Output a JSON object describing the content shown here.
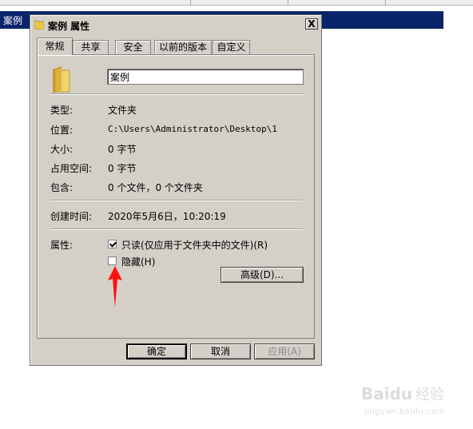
{
  "background": {
    "selected_row_label": "案例",
    "row_color": "#0a246a"
  },
  "dialog": {
    "title": "案例 属性",
    "close_label": "X",
    "tabs": [
      {
        "label": "常规",
        "active": true
      },
      {
        "label": "共享",
        "active": false
      },
      {
        "label": "安全",
        "active": false
      },
      {
        "label": "以前的版本",
        "active": false
      },
      {
        "label": "自定义",
        "active": false
      }
    ],
    "general": {
      "folder_name": "案例",
      "type_label": "类型:",
      "type_value": "文件夹",
      "location_label": "位置:",
      "location_value": "C:\\Users\\Administrator\\Desktop\\1",
      "size_label": "大小:",
      "size_value": "0 字节",
      "size_on_disk_label": "占用空间:",
      "size_on_disk_value": "0 字节",
      "contains_label": "包含:",
      "contains_value": "0 个文件，0 个文件夹",
      "created_label": "创建时间:",
      "created_value": "2020年5月6日，10:20:19",
      "attributes_label": "属性:",
      "readonly_label": "只读(仅应用于文件夹中的文件)(R)",
      "readonly_checked": true,
      "hidden_label": "隐藏(H)",
      "hidden_checked": false,
      "advanced_label": "高级(D)..."
    },
    "buttons": {
      "ok": "确定",
      "cancel": "取消",
      "apply": "应用(A)"
    }
  },
  "annotation": {
    "arrow_color": "#ff1010"
  },
  "watermark": {
    "brand": "Baidu",
    "suffix": "经验",
    "url": "jingyan.baidu.com"
  }
}
